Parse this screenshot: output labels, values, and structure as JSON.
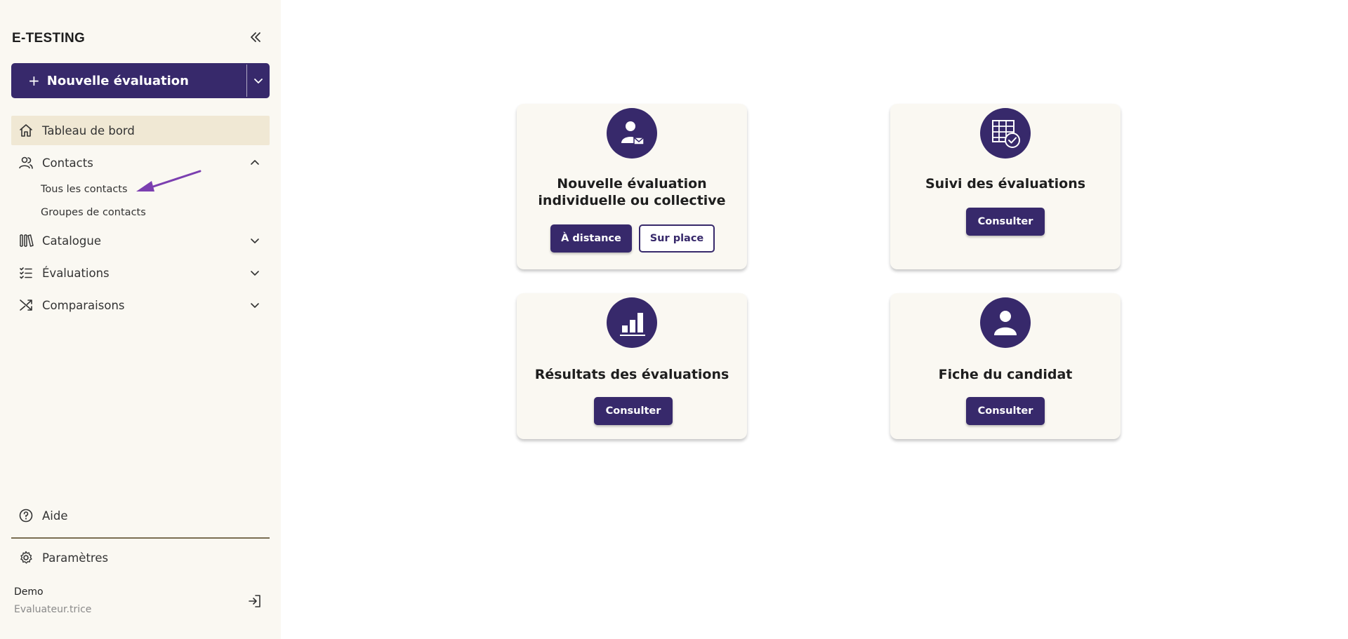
{
  "brand": {
    "logo_text_a": "E-TESTI",
    "logo_text_accent": "",
    "logo_text_b": "NG"
  },
  "sidebar": {
    "new_eval_label": "Nouvelle évaluation",
    "items": [
      {
        "label": "Tableau de bord",
        "icon": "home-icon"
      },
      {
        "label": "Contacts",
        "icon": "users-icon"
      },
      {
        "label": "Catalogue",
        "icon": "books-icon"
      },
      {
        "label": "Évaluations",
        "icon": "list-icon"
      },
      {
        "label": "Comparaisons",
        "icon": "shuffle-icon"
      }
    ],
    "contacts_sub": [
      {
        "label": "Tous les contacts"
      },
      {
        "label": "Groupes de contacts"
      }
    ],
    "help_label": "Aide",
    "settings_label": "Paramètres",
    "user": {
      "name": "Demo",
      "role": "Evaluateur.trice"
    }
  },
  "cards": {
    "new_eval": {
      "title_line1": "Nouvelle évaluation",
      "title_line2": "individuelle ou collective",
      "btn_remote": "À distance",
      "btn_onsite": "Sur place"
    },
    "followup": {
      "title": "Suivi des évaluations",
      "btn": "Consulter"
    },
    "results": {
      "title": "Résultats des évaluations",
      "btn": "Consulter"
    },
    "candidate": {
      "title": "Fiche du candidat",
      "btn": "Consulter"
    }
  },
  "colors": {
    "primary": "#37296b",
    "sidebar_bg": "#faf8f2",
    "active_bg": "#f0e8d4",
    "arrow": "#7b3fb0"
  }
}
